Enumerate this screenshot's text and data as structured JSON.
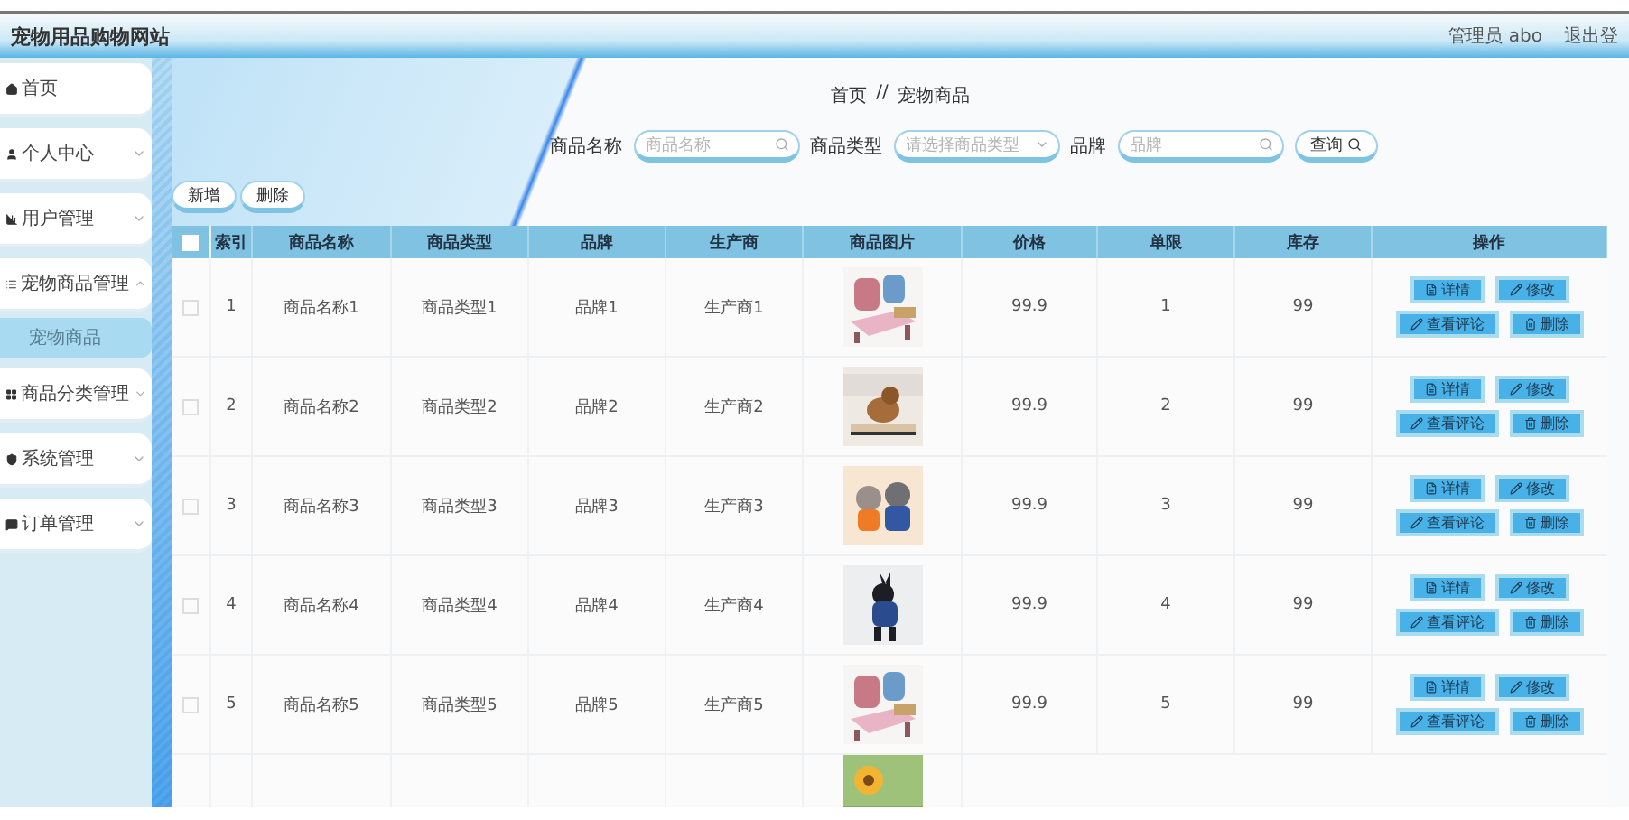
{
  "header": {
    "title": "宠物用品购物网站",
    "user": "管理员 abo",
    "logout": "退出登"
  },
  "sidebar": {
    "items": [
      {
        "label": "首页"
      },
      {
        "label": "个人中心",
        "expanded": false
      },
      {
        "label": "用户管理",
        "expanded": false
      },
      {
        "label": "宠物商品管理",
        "expanded": true,
        "children": [
          {
            "label": "宠物商品",
            "selected": true
          }
        ]
      },
      {
        "label": "商品分类管理",
        "expanded": false
      },
      {
        "label": "系统管理",
        "expanded": false
      },
      {
        "label": "订单管理",
        "expanded": false
      }
    ]
  },
  "breadcrumb": [
    "首页",
    "//",
    "宠物商品"
  ],
  "search": {
    "fields": [
      {
        "label": "商品名称",
        "placeholder": "商品名称",
        "kind": "text"
      },
      {
        "label": "商品类型",
        "placeholder": "请选择商品类型",
        "kind": "select"
      },
      {
        "label": "品牌",
        "placeholder": "品牌",
        "kind": "text"
      }
    ],
    "button": "查询"
  },
  "actions": [
    "新增",
    "删除"
  ],
  "table": {
    "header_checked": false,
    "columns": [
      "",
      "索引",
      "商品名称",
      "商品类型",
      "品牌",
      "生产商",
      "商品图片",
      "价格",
      "单限",
      "库存",
      "操作"
    ],
    "rows": [
      {
        "checked": false,
        "cells": [
          "",
          "1",
          "商品名称1",
          "商品类型1",
          "品牌1",
          "生产商1",
          "",
          "99.9",
          "1",
          "99"
        ],
        "actions": [
          "详情",
          "修改",
          "查看评论",
          "删除"
        ]
      },
      {
        "checked": false,
        "cells": [
          "",
          "2",
          "商品名称2",
          "商品类型2",
          "品牌2",
          "生产商2",
          "",
          "99.9",
          "2",
          "99"
        ],
        "actions": [
          "详情",
          "修改",
          "查看评论",
          "删除"
        ]
      },
      {
        "checked": false,
        "cells": [
          "",
          "3",
          "商品名称3",
          "商品类型3",
          "品牌3",
          "生产商3",
          "",
          "99.9",
          "3",
          "99"
        ],
        "actions": [
          "详情",
          "修改",
          "查看评论",
          "删除"
        ]
      },
      {
        "checked": false,
        "cells": [
          "",
          "4",
          "商品名称4",
          "商品类型4",
          "品牌4",
          "生产商4",
          "",
          "99.9",
          "4",
          "99"
        ],
        "actions": [
          "详情",
          "修改",
          "查看评论",
          "删除"
        ]
      },
      {
        "checked": false,
        "cells": [
          "",
          "5",
          "商品名称5",
          "商品类型5",
          "品牌5",
          "生产商5",
          "",
          "99.9",
          "5",
          "99"
        ],
        "actions": [
          "详情",
          "修改",
          "查看评论",
          "删除"
        ]
      }
    ],
    "more_rows_below": true
  }
}
